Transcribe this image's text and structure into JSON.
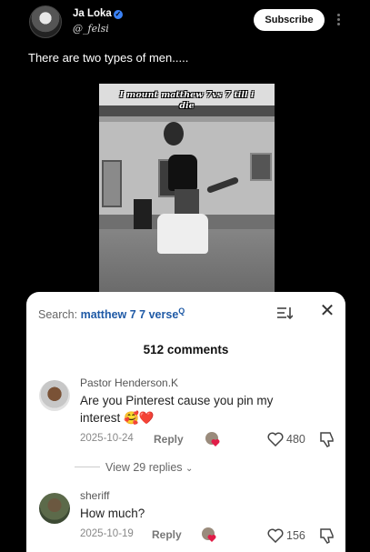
{
  "post": {
    "author_name": "Ja Loka",
    "handle": "@_felsi",
    "subscribe_label": "Subscribe",
    "caption": "There are two types of men.....",
    "video_overlay_text": "I mount matthew 7vs 7 till i die"
  },
  "comments_panel": {
    "search_label": "Search:",
    "search_term": "matthew 7 7 verse",
    "count_text": "512 comments",
    "comments": [
      {
        "author": "Pastor Henderson.K",
        "text": "Are you Pinterest cause you pin my interest 🥰❤️",
        "date": "2025-10-24",
        "reply_label": "Reply",
        "likes": "480"
      },
      {
        "author": "sheriff",
        "text": "How much?",
        "date": "2025-10-19",
        "reply_label": "Reply",
        "likes": "156"
      }
    ],
    "view_replies_label": "View 29 replies"
  },
  "colors": {
    "background": "#000000",
    "sheet": "#ffffff",
    "search_term": "#1f5aa6",
    "verified": "#3b82f6"
  },
  "icons": [
    "verified-badge-icon",
    "more-vertical-icon",
    "sort-icon",
    "close-icon",
    "heart-outline-icon",
    "thumbs-down-icon",
    "creator-heart-reaction-icon",
    "chevron-down-icon"
  ]
}
